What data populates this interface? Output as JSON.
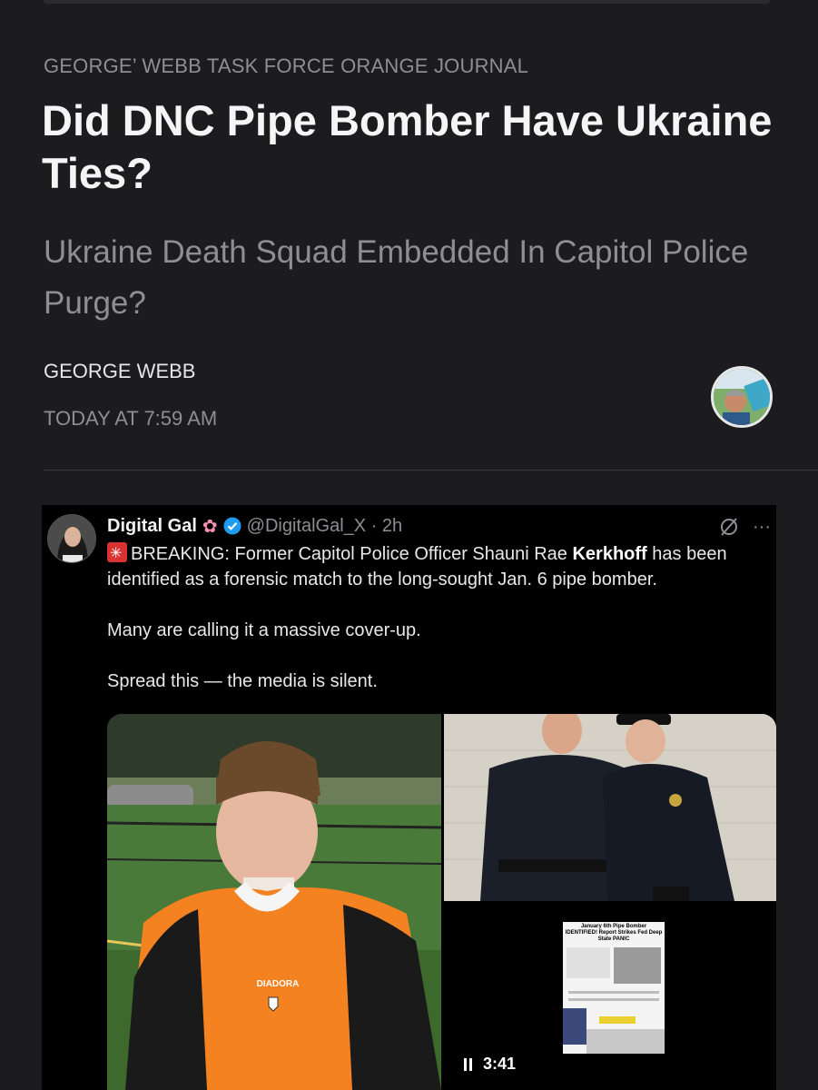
{
  "article": {
    "publication": "GEORGE’ WEBB TASK FORCE ORANGE JOURNAL",
    "title": "Did DNC Pipe Bomber Have Ukraine Ties?",
    "subtitle": "Ukraine Death Squad Embedded In Capitol Police Purge?",
    "author": "GEORGE WEBB",
    "date": "TODAY AT 7:59 AM"
  },
  "tweet": {
    "name": "Digital Gal",
    "handle": "@DigitalGal_X · 2h",
    "more": "···",
    "line1_pre": "BREAKING: Former Capitol Police Officer Shauni Rae ",
    "line1_bold": "Kerkhoff",
    "line1_post": " has been identified as a forensic match to the long-sought Jan. 6 pipe bomber.",
    "line2": "Many are calling it a massive cover-up.",
    "line3": "Spread this — the media is silent.",
    "video_time": "3:41",
    "jersey_brand": "DIADORA",
    "thumb_headline": "January 6th Pipe Bomber IDENTIFIED! Report Strikes Fed Deep State PANIC",
    "icons": {
      "verified": "verified-badge-icon",
      "flower": "flower-emoji-icon",
      "siren": "siren-emoji-icon",
      "grok": "grok-icon",
      "pause": "pause-icon"
    }
  },
  "colors": {
    "background": "#1c1c1e",
    "muted": "#8e8e93",
    "verified": "#1d9bf0",
    "siren": "#d83232"
  }
}
